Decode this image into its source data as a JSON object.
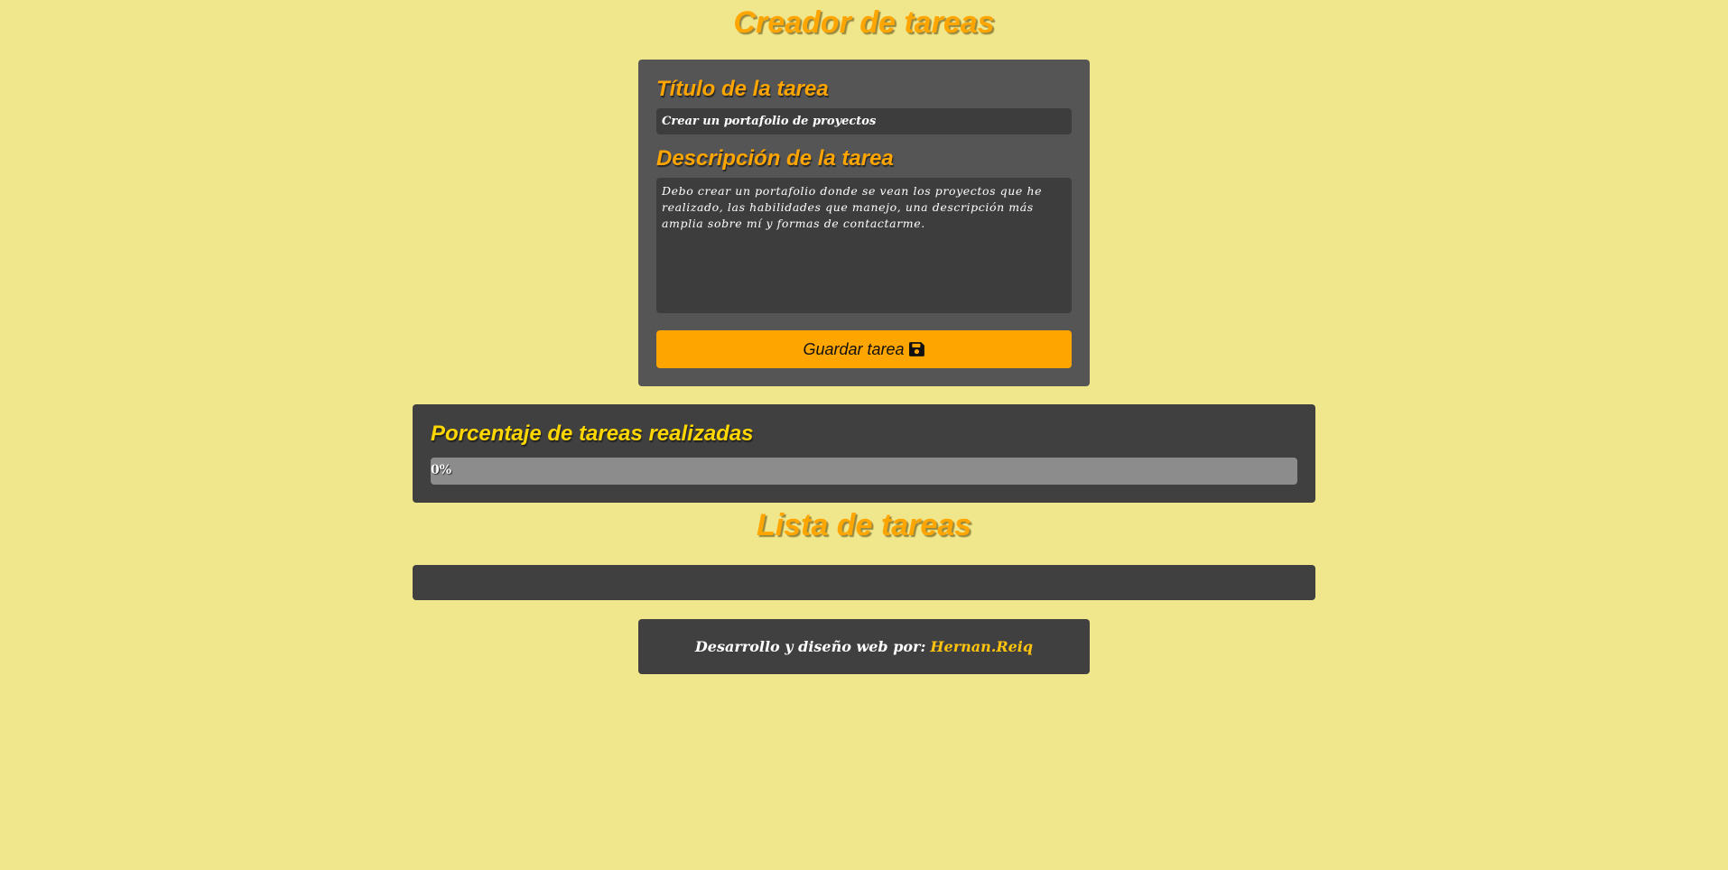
{
  "app": {
    "title": "Creador de tareas"
  },
  "form": {
    "title_label": "Título de la tarea",
    "title_value": "Crear un portafolio de proyectos",
    "description_label": "Descripción de la tarea",
    "description_value": "Debo crear un portafolio donde se vean los proyectos que he realizado, las habilidades que manejo, una descripción más amplia sobre mí y formas de contactarme.",
    "save_label": "Guardar tarea",
    "save_icon": "floppy-disk-icon"
  },
  "progress": {
    "heading": "Porcentaje de tareas realizadas",
    "percent": 0,
    "text": "0%"
  },
  "task_list": {
    "title": "Lista de tareas",
    "items": []
  },
  "footer": {
    "text": "Desarrollo y diseño web por:",
    "author": "Hernan.Reiq"
  },
  "colors": {
    "background": "#f0e68c",
    "accent": "#ffa500",
    "panel": "#404040",
    "form_panel": "#555555",
    "input": "#3d3d3d",
    "heading_gold": "#ffd700"
  }
}
